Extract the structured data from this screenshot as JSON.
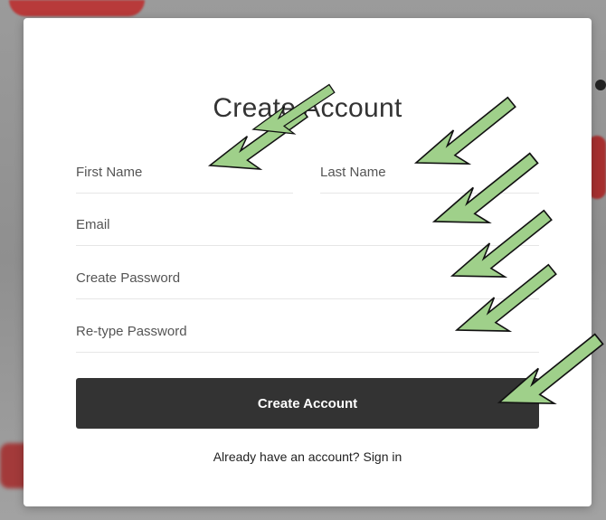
{
  "modal": {
    "title": "Create Account",
    "fields": {
      "first_name": {
        "placeholder": "First Name",
        "value": ""
      },
      "last_name": {
        "placeholder": "Last Name",
        "value": ""
      },
      "email": {
        "placeholder": "Email",
        "value": ""
      },
      "password": {
        "placeholder": "Create Password",
        "value": ""
      },
      "retype_password": {
        "placeholder": "Re-type Password",
        "value": ""
      }
    },
    "submit_label": "Create Account",
    "signin_prompt": "Already have an account?",
    "signin_link": "Sign in"
  },
  "annotations": {
    "arrow_color": "#9fd08a",
    "arrow_count": 6
  },
  "colors": {
    "button_bg": "#333333",
    "modal_bg": "#ffffff"
  }
}
